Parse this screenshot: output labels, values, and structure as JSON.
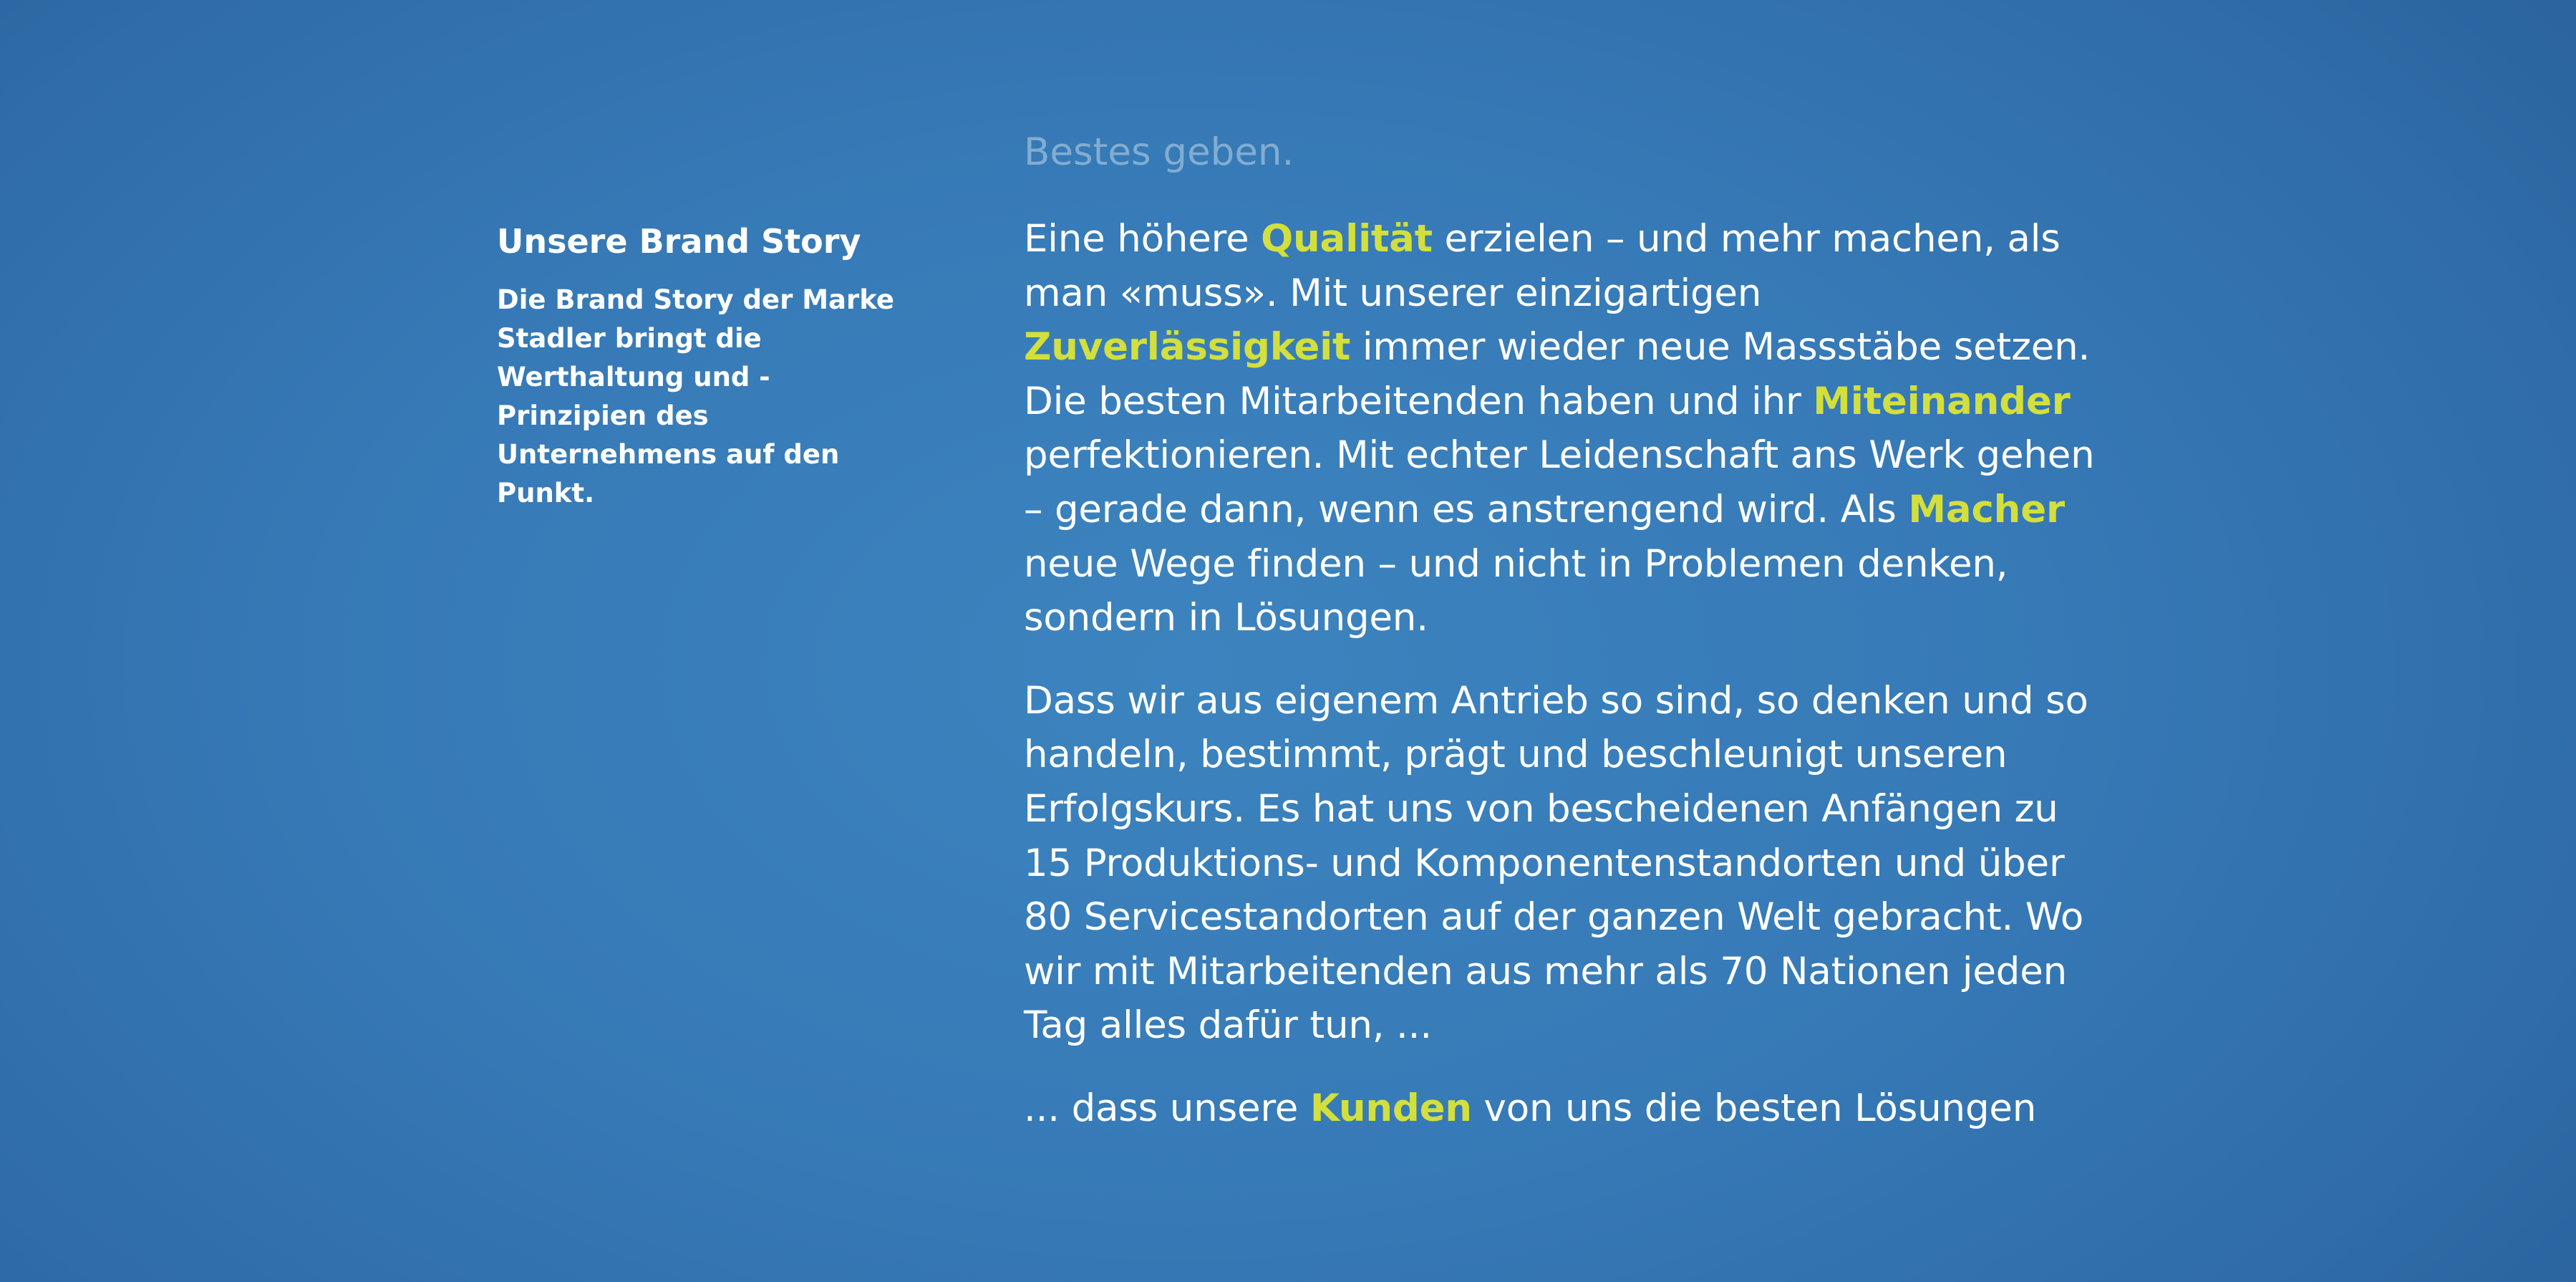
{
  "colors": {
    "background": "#3679b6",
    "text": "#ffffff",
    "highlight": "#d3df3c"
  },
  "sidebar": {
    "title": "Unsere Brand Story",
    "description": "Die Brand Story der Marke Stadler bringt die Werthaltung und -Prinzipien des Unternehmens auf den Punkt."
  },
  "main": {
    "fade_line": "Bestes geben.",
    "paragraph1": {
      "t1": "Eine höhere ",
      "h1": "Qualität",
      "t2": " erzielen – und mehr machen, als man «muss». Mit unserer einzigartigen ",
      "h2": "Zuverlässigkeit",
      "t3": " immer wieder neue Massstäbe setzen. Die besten Mitarbeitenden haben und ihr ",
      "h3": "Miteinander",
      "t4": " perfektionieren. Mit echter Leidenschaft ans Werk gehen – gerade dann, wenn es anstrengend wird. Als ",
      "h4": "Macher",
      "t5": " neue Wege finden – und nicht in Problemen denken, sondern in Lösungen."
    },
    "paragraph2": "Dass wir aus eigenem Antrieb so sind, so denken und so handeln, bestimmt, prägt und beschleunigt unseren Erfolgskurs. Es hat uns von bescheidenen Anfängen zu 15 Produktions- und Komponentenstandorten und über 80 Servicestandorten auf der ganzen Welt gebracht. Wo wir mit Mitarbeitenden aus mehr als 70 Nationen jeden Tag alles dafür tun, ...",
    "paragraph3": {
      "t1": "... dass unsere ",
      "h1": "Kunden",
      "t2": " von uns die besten Lösungen"
    }
  }
}
